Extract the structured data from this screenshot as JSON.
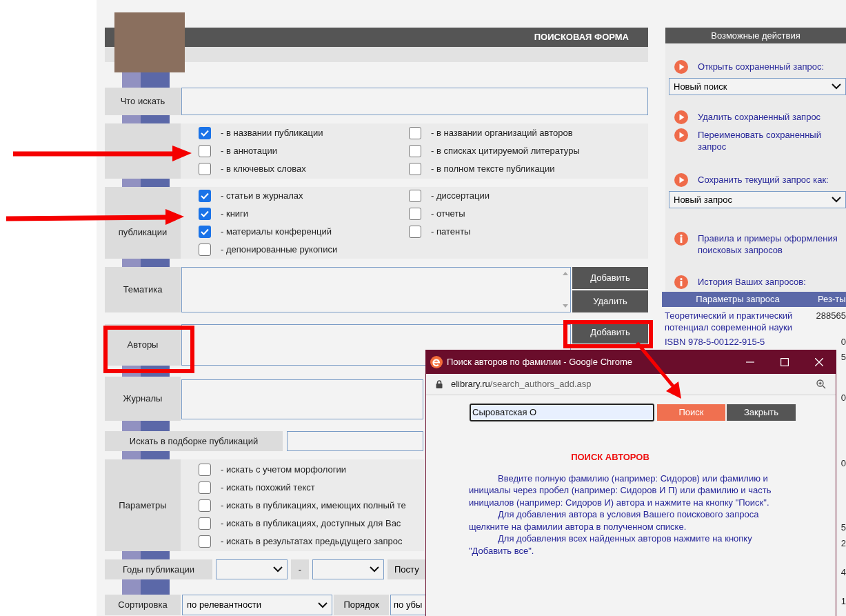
{
  "search_form": {
    "title": "ПОИСКОВАЯ ФОРМА",
    "what": {
      "label": "Что искать"
    },
    "where": {
      "options": [
        {
          "label": "- в названии публикации",
          "checked": true
        },
        {
          "label": "- в названии организаций авторов",
          "checked": false
        },
        {
          "label": "- в аннотации",
          "checked": false
        },
        {
          "label": "- в списках цитируемой литературы",
          "checked": false
        },
        {
          "label": "- в ключевых словах",
          "checked": false
        },
        {
          "label": "- в полном тексте публикации",
          "checked": false
        }
      ]
    },
    "pub_type": {
      "label": "публикации",
      "options": [
        {
          "label": "- статьи в журналах",
          "checked": true
        },
        {
          "label": "- диссертации",
          "checked": false
        },
        {
          "label": "- книги",
          "checked": true
        },
        {
          "label": "- отчеты",
          "checked": false
        },
        {
          "label": "- материалы конференций",
          "checked": true
        },
        {
          "label": "- патенты",
          "checked": false
        },
        {
          "label": "- депонированные рукописи",
          "checked": false
        }
      ]
    },
    "topics": {
      "label": "Тематика",
      "buttons": [
        "Добавить",
        "Удалить"
      ]
    },
    "authors": {
      "label": "Авторы",
      "button": "Добавить"
    },
    "journals": {
      "label": "Журналы"
    },
    "collection": {
      "label": "Искать в подборке публикаций"
    },
    "params": {
      "label": "Параметры",
      "options": [
        {
          "label": "- искать с учетом морфологии",
          "checked": false
        },
        {
          "label": "- искать похожий текст",
          "checked": false
        },
        {
          "label": "- искать в публикациях, имеющих полный те",
          "checked": false
        },
        {
          "label": "- искать в публикациях, доступных для Вас",
          "checked": false
        },
        {
          "label": "- искать в результатах предыдущего запрос",
          "checked": false
        }
      ]
    },
    "years": {
      "label": "Годы публикации",
      "separator": "-",
      "column_5": "Посту"
    },
    "sorting": {
      "label": "Сортировка",
      "value": "по релевантности",
      "order_label": "Порядок",
      "order_value": "по убы"
    }
  },
  "actions_panel": {
    "title": "Возможные действия",
    "items": [
      {
        "kind": "play",
        "label": "Открыть сохраненный запрос:",
        "select": "Новый поиск"
      },
      {
        "kind": "play",
        "label": "Удалить сохраненный запрос"
      },
      {
        "kind": "play",
        "label": "Переименовать сохраненный запрос"
      },
      {
        "kind": "play",
        "label": "Сохранить текущий запрос как:",
        "select": "Новый запрос"
      },
      {
        "kind": "info",
        "label": "Правила и примеры оформления поисковых запросов"
      },
      {
        "kind": "info",
        "label": "История Ваших запросов:"
      }
    ],
    "history": {
      "columns": [
        "Параметры запроса",
        "Рез-ты"
      ],
      "rows": [
        {
          "params": "Теоретический и практический потенциал современной науки",
          "result": "288565"
        },
        {
          "params": "ISBN 978-5-00122-915-5",
          "result": "0"
        }
      ],
      "result_fragments": [
        "5",
        "0",
        "0",
        "5",
        "2",
        "4",
        "1"
      ]
    }
  },
  "popup": {
    "title": "Поиск авторов по фамилии - Google Chrome",
    "url_host": "elibrary.ru",
    "url_path": "/search_authors_add.asp",
    "query": "Сыроватская О",
    "search_button": "Поиск",
    "close_button": "Закрыть",
    "heading": "ПОИСК АВТОРОВ",
    "paragraphs": [
      "Введите полную фамилию (например: Сидоров) или фамилию и инициалы через пробел (например: Сидоров И П) или фамилию и часть инициалов (например: Сидоров И) автора и нажмите на кнопку \"Поиск\".",
      "Для добавления автора в условия Вашего поискового запроса щелкните на фамилии автора в полученном списке.",
      "Для добавления всех найденных авторов нажмите на кнопку \"Добавить все\"."
    ]
  }
}
